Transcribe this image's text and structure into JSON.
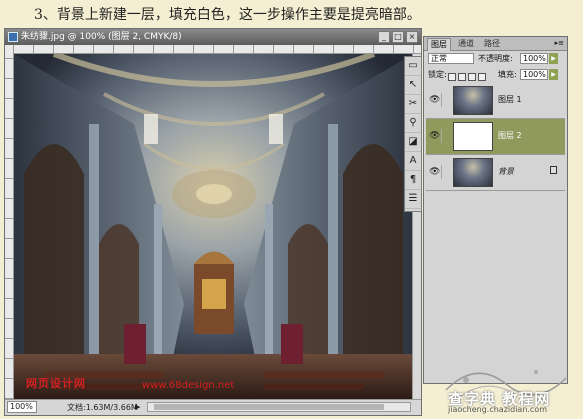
{
  "instruction": "3、背景上新建一层，填充白色，这一步操作主要是提亮暗部。",
  "document": {
    "title": "朱纺骤.jpg @ 100% (图层 2, CMYK/8)",
    "zoom": "100%",
    "info": "文档:1.63M/3.66M",
    "watermark_cn": "网页设计网",
    "watermark_url": "www.68design.net",
    "controls": {
      "minimize": "_",
      "maximize": "□",
      "close": "×"
    }
  },
  "tools": [
    {
      "icon": "move-tool-icon",
      "glyph": "▭"
    },
    {
      "icon": "pointer-tool-icon",
      "glyph": "↖"
    },
    {
      "icon": "crop-tool-icon",
      "glyph": "✂"
    },
    {
      "icon": "stamp-tool-icon",
      "glyph": "⚲"
    },
    {
      "icon": "eraser-tool-icon",
      "glyph": "◪"
    },
    {
      "icon": "pen-tool-icon",
      "glyph": "A"
    },
    {
      "icon": "text-tool-icon",
      "glyph": "¶"
    },
    {
      "icon": "hand-tool-icon",
      "glyph": "☰"
    }
  ],
  "layers_panel": {
    "tabs": [
      "图层",
      "通道",
      "路径"
    ],
    "blend_mode": "正常",
    "opacity_label": "不透明度:",
    "opacity_value": "100%",
    "lock_label": "锁定:",
    "fill_label": "填充:",
    "fill_value": "100%",
    "layers": [
      {
        "name": "图层 1",
        "thumb": "photo",
        "selected": false
      },
      {
        "name": "图层 2",
        "thumb": "white",
        "selected": true
      },
      {
        "name": "背景",
        "thumb": "photo",
        "selected": false,
        "locked": true
      }
    ]
  },
  "footer": {
    "site_name": "查字典 教程网",
    "site_url": "jiaocheng.chazidian.com"
  }
}
